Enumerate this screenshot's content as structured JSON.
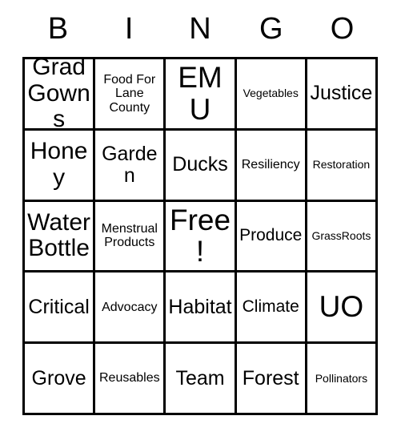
{
  "card": {
    "header_letters": [
      "B",
      "I",
      "N",
      "G",
      "O"
    ],
    "rows": [
      [
        {
          "text": "Grad Gowns",
          "size": "lg"
        },
        {
          "text": "Food For Lane County",
          "size": "xs"
        },
        {
          "text": "EMU",
          "size": "xl"
        },
        {
          "text": "Vegetables",
          "size": "xxs"
        },
        {
          "text": "Justice",
          "size": "md"
        }
      ],
      [
        {
          "text": "Honey",
          "size": "lg"
        },
        {
          "text": "Garden",
          "size": "md"
        },
        {
          "text": "Ducks",
          "size": "md"
        },
        {
          "text": "Resiliency",
          "size": "xs"
        },
        {
          "text": "Restoration",
          "size": "xxs"
        }
      ],
      [
        {
          "text": "Water Bottle",
          "size": "lg"
        },
        {
          "text": "Menstrual Products",
          "size": "xs"
        },
        {
          "text": "Free!",
          "size": "xl"
        },
        {
          "text": "Produce",
          "size": "sm"
        },
        {
          "text": "GrassRoots",
          "size": "xxs"
        }
      ],
      [
        {
          "text": "Critical",
          "size": "md"
        },
        {
          "text": "Advocacy",
          "size": "xs"
        },
        {
          "text": "Habitat",
          "size": "md"
        },
        {
          "text": "Climate",
          "size": "sm"
        },
        {
          "text": "UO",
          "size": "xl"
        }
      ],
      [
        {
          "text": "Grove",
          "size": "md"
        },
        {
          "text": "Reusables",
          "size": "xs"
        },
        {
          "text": "Team",
          "size": "md"
        },
        {
          "text": "Forest",
          "size": "md"
        },
        {
          "text": "Pollinators",
          "size": "xxs"
        }
      ]
    ],
    "colors": {
      "background": "#ffffff",
      "border": "#000000",
      "text": "#000000"
    }
  }
}
